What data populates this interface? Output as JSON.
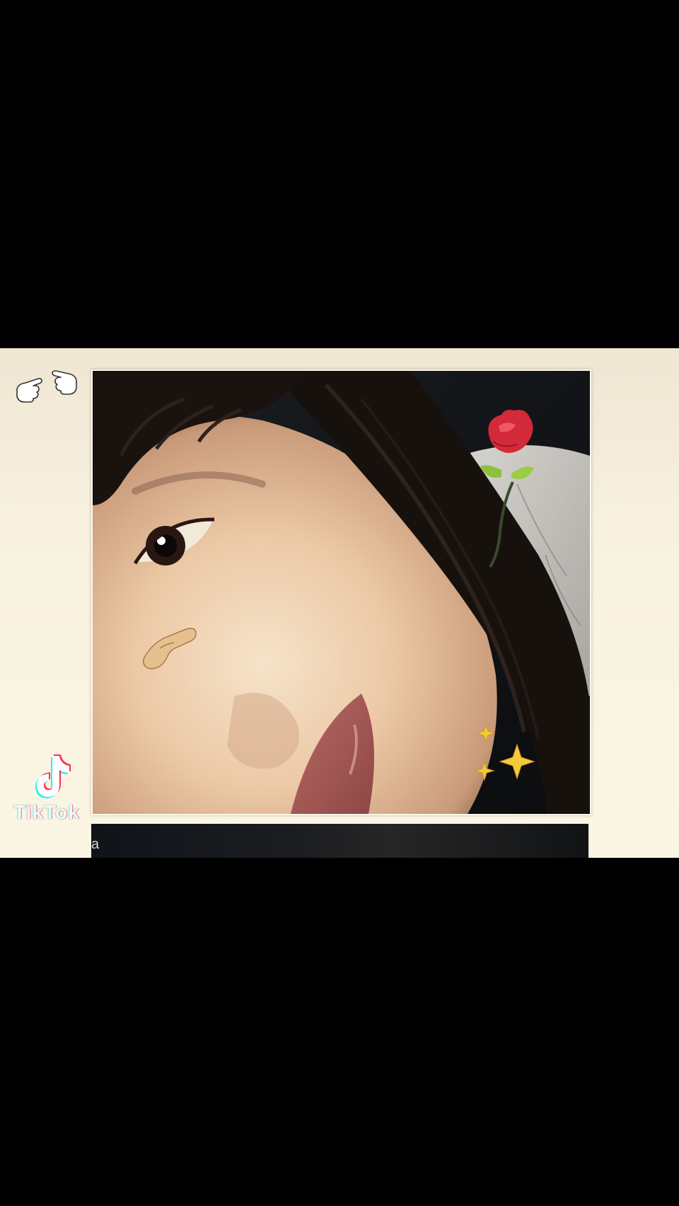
{
  "screen": {
    "background": "#000000",
    "frame_background": "#f8f1df"
  },
  "sticker": {
    "hands_icon": "pointing-hands-icon",
    "rose_icon": "rose-icon",
    "sparkles_icon": "sparkles-icon",
    "nose_sticker_icon": "nose-pointer-icon"
  },
  "watermark": {
    "logo_icon": "tiktok-logo-icon",
    "wordmark": "TikTok",
    "colors": {
      "cyan": "#25f4ee",
      "red": "#fe2c55",
      "white": "#ffffff"
    }
  },
  "next_card": {
    "partial_text": "a"
  }
}
